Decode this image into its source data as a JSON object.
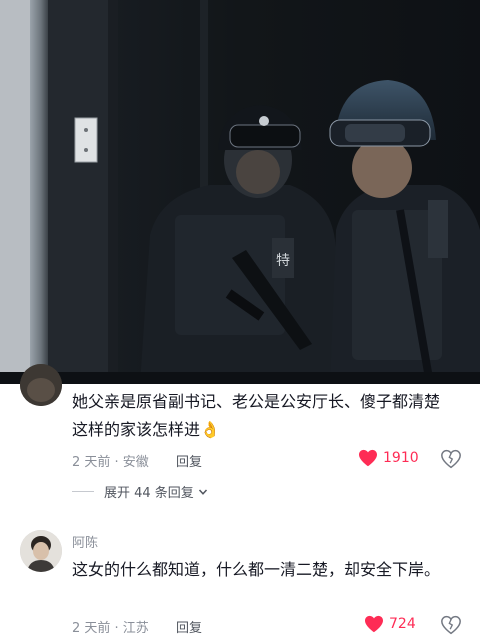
{
  "comments": [
    {
      "text": "她父亲是原省副书记、老公是公安厅长、傻子都清楚这样的家该怎样进",
      "emoji": "👌",
      "time_location": "2 天前 · 安徽",
      "reply_label": "回复",
      "likes": "1910",
      "expand_label": "展开 44 条回复"
    },
    {
      "username": "阿陈",
      "text": "这女的什么都知道，什么都一清二楚，却安全下岸。",
      "time_location": "2 天前 · 江苏",
      "reply_label": "回复",
      "likes": "724"
    }
  ],
  "video": {
    "vest_label": "特"
  },
  "icons": {
    "like": "heart-icon",
    "dislike": "broken-heart-icon",
    "expand": "chevron-down-icon"
  },
  "colors": {
    "like": "#fe2c55",
    "text": "#161823",
    "meta": "#8a8f99"
  }
}
